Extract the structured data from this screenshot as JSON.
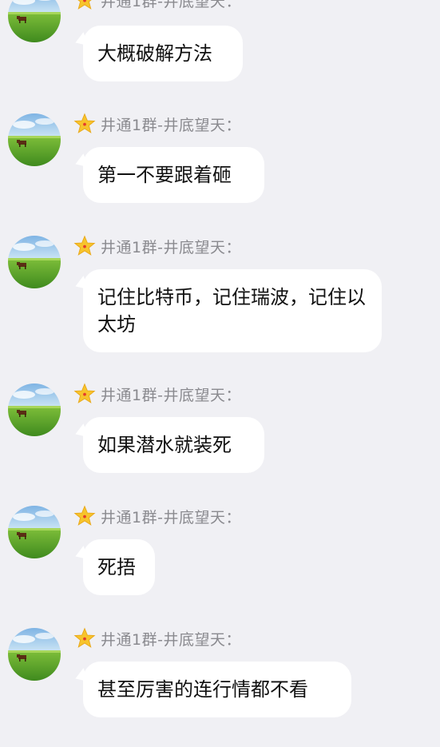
{
  "sender": {
    "name": "井通1群-井底望天："
  },
  "messages": [
    {
      "text": "大概破解方法"
    },
    {
      "text": "第一不要跟着砸"
    },
    {
      "text": "记住比特币，记住瑞波，记住以太坊"
    },
    {
      "text": "如果潜水就装死"
    },
    {
      "text": "死捂"
    },
    {
      "text": "甚至厉害的连行情都不看"
    }
  ],
  "icons": {
    "avatar": "landscape-cow-avatar-icon",
    "badge": "star-icon"
  },
  "colors": {
    "background": "#f0f0f4",
    "bubble": "#ffffff",
    "sender_text": "#8a8a8f",
    "star": "#f7c42c"
  }
}
